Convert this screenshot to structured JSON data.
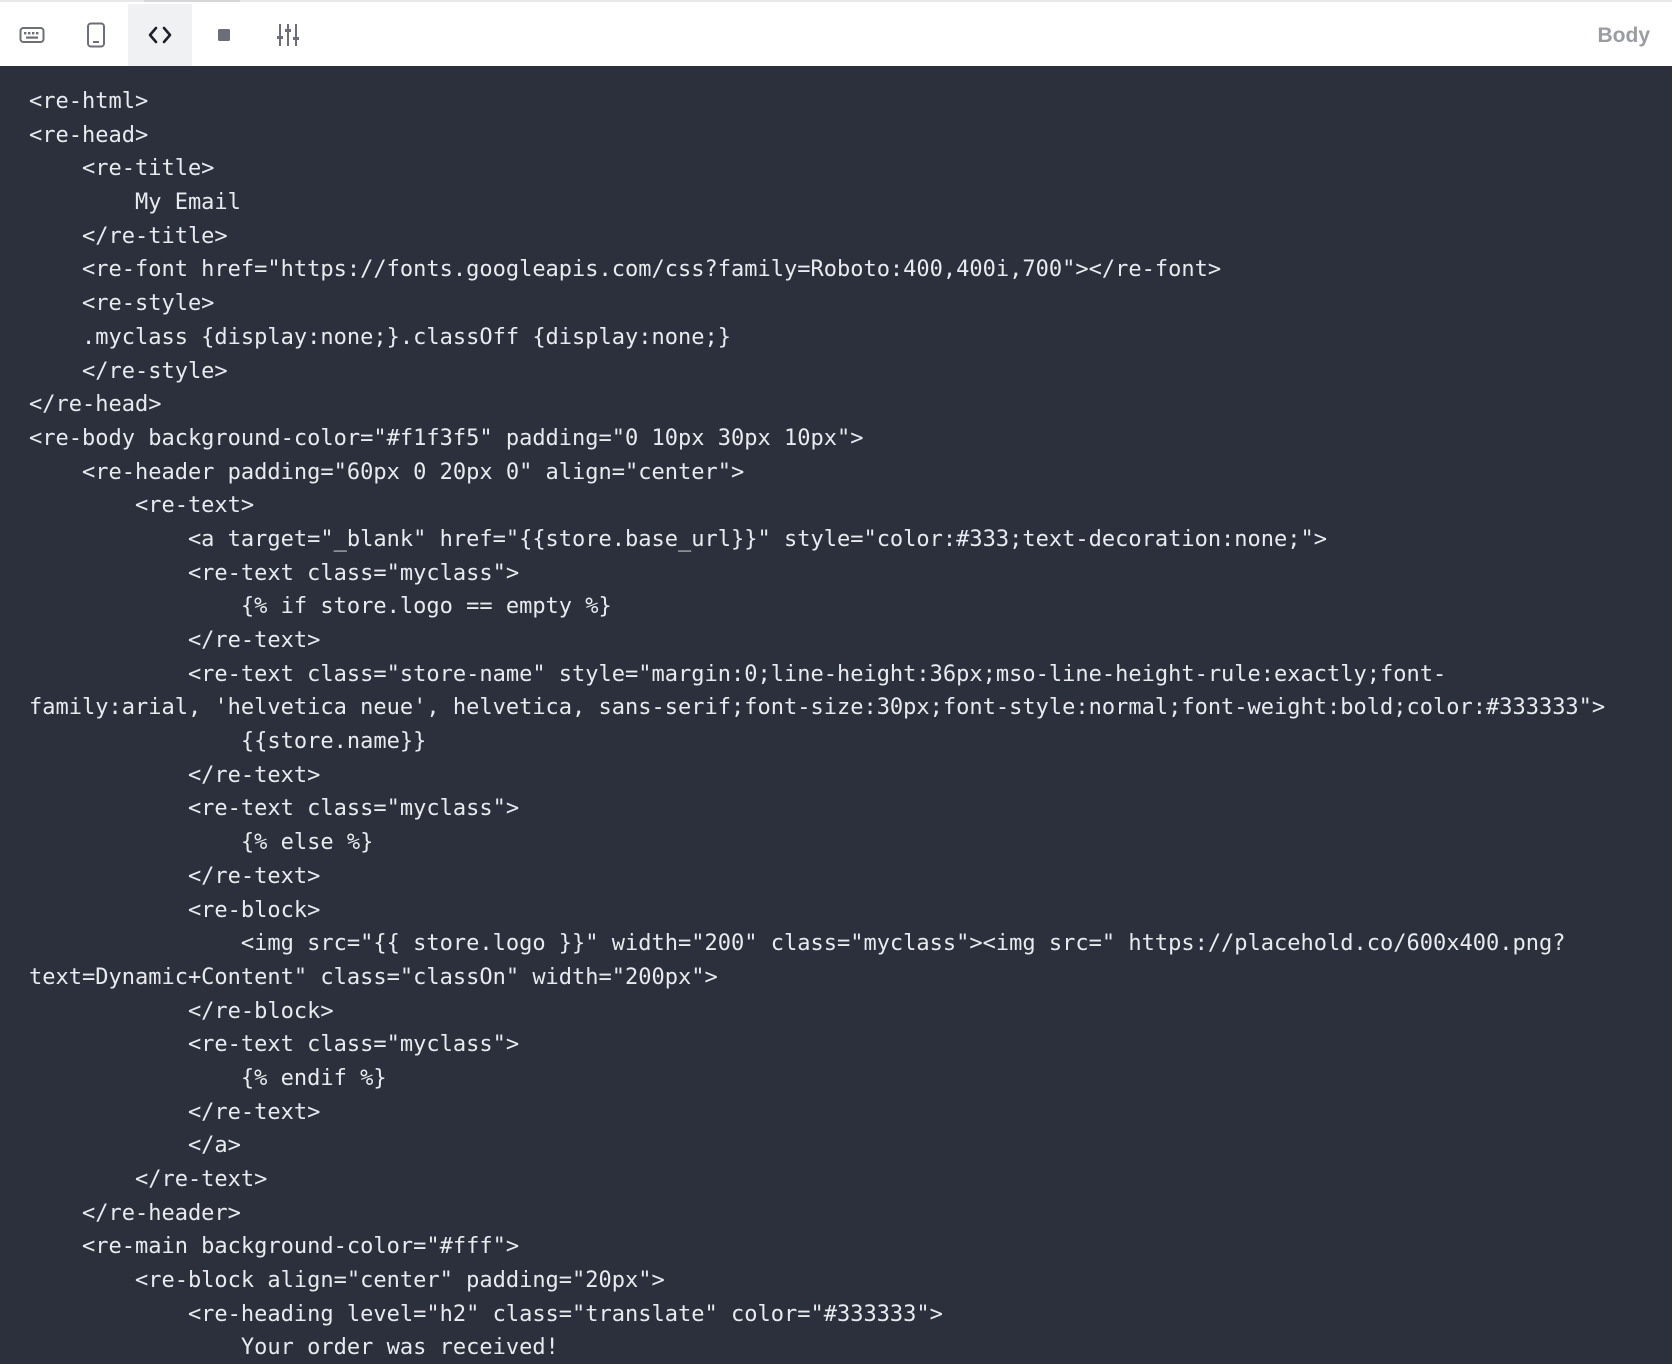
{
  "toolbar": {
    "buttons": [
      {
        "name": "keyboard-view-button",
        "icon": "keyboard-icon"
      },
      {
        "name": "mobile-view-button",
        "icon": "tablet-icon"
      },
      {
        "name": "code-view-button",
        "icon": "code-brackets-icon",
        "active": true
      },
      {
        "name": "stop-button",
        "icon": "square-icon"
      },
      {
        "name": "settings-button",
        "icon": "sliders-icon"
      }
    ],
    "section_label": "Body"
  },
  "editor": {
    "lines": [
      "<re-html>",
      "<re-head>",
      "    <re-title>",
      "        My Email",
      "    </re-title>",
      "    <re-font href=\"https://fonts.googleapis.com/css?family=Roboto:400,400i,700\"></re-font>",
      "    <re-style>",
      "    .myclass {display:none;}.classOff {display:none;}",
      "    </re-style>",
      "</re-head>",
      "<re-body background-color=\"#f1f3f5\" padding=\"0 10px 30px 10px\">",
      "    <re-header padding=\"60px 0 20px 0\" align=\"center\">",
      "        <re-text>",
      "            <a target=\"_blank\" href=\"{{store.base_url}}\" style=\"color:#333;text-decoration:none;\">",
      "            <re-text class=\"myclass\">",
      "                {% if store.logo == empty %}",
      "            </re-text>",
      "            <re-text class=\"store-name\" style=\"margin:0;line-height:36px;mso-line-height-rule:exactly;font-",
      "family:arial, 'helvetica neue', helvetica, sans-serif;font-size:30px;font-style:normal;font-weight:bold;color:#333333\">",
      "                {{store.name}}",
      "            </re-text>",
      "            <re-text class=\"myclass\">",
      "                {% else %}",
      "            </re-text>",
      "            <re-block>",
      "                <img src=\"{{ store.logo }}\" width=\"200\" class=\"myclass\"><img src=\" https://placehold.co/600x400.png?",
      "text=Dynamic+Content\" class=\"classOn\" width=\"200px\">",
      "            </re-block>",
      "            <re-text class=\"myclass\">",
      "                {% endif %}",
      "            </re-text>",
      "            </a>",
      "        </re-text>",
      "    </re-header>",
      "    <re-main background-color=\"#fff\">",
      "        <re-block align=\"center\" padding=\"20px\">",
      "            <re-heading level=\"h2\" class=\"translate\" color=\"#333333\">",
      "                Your order was received!"
    ]
  },
  "colors": {
    "editor_background": "#2b303c",
    "code_text": "#e9eaee",
    "toolbar_background": "#ffffff",
    "label_gray": "#9a9ca3"
  }
}
